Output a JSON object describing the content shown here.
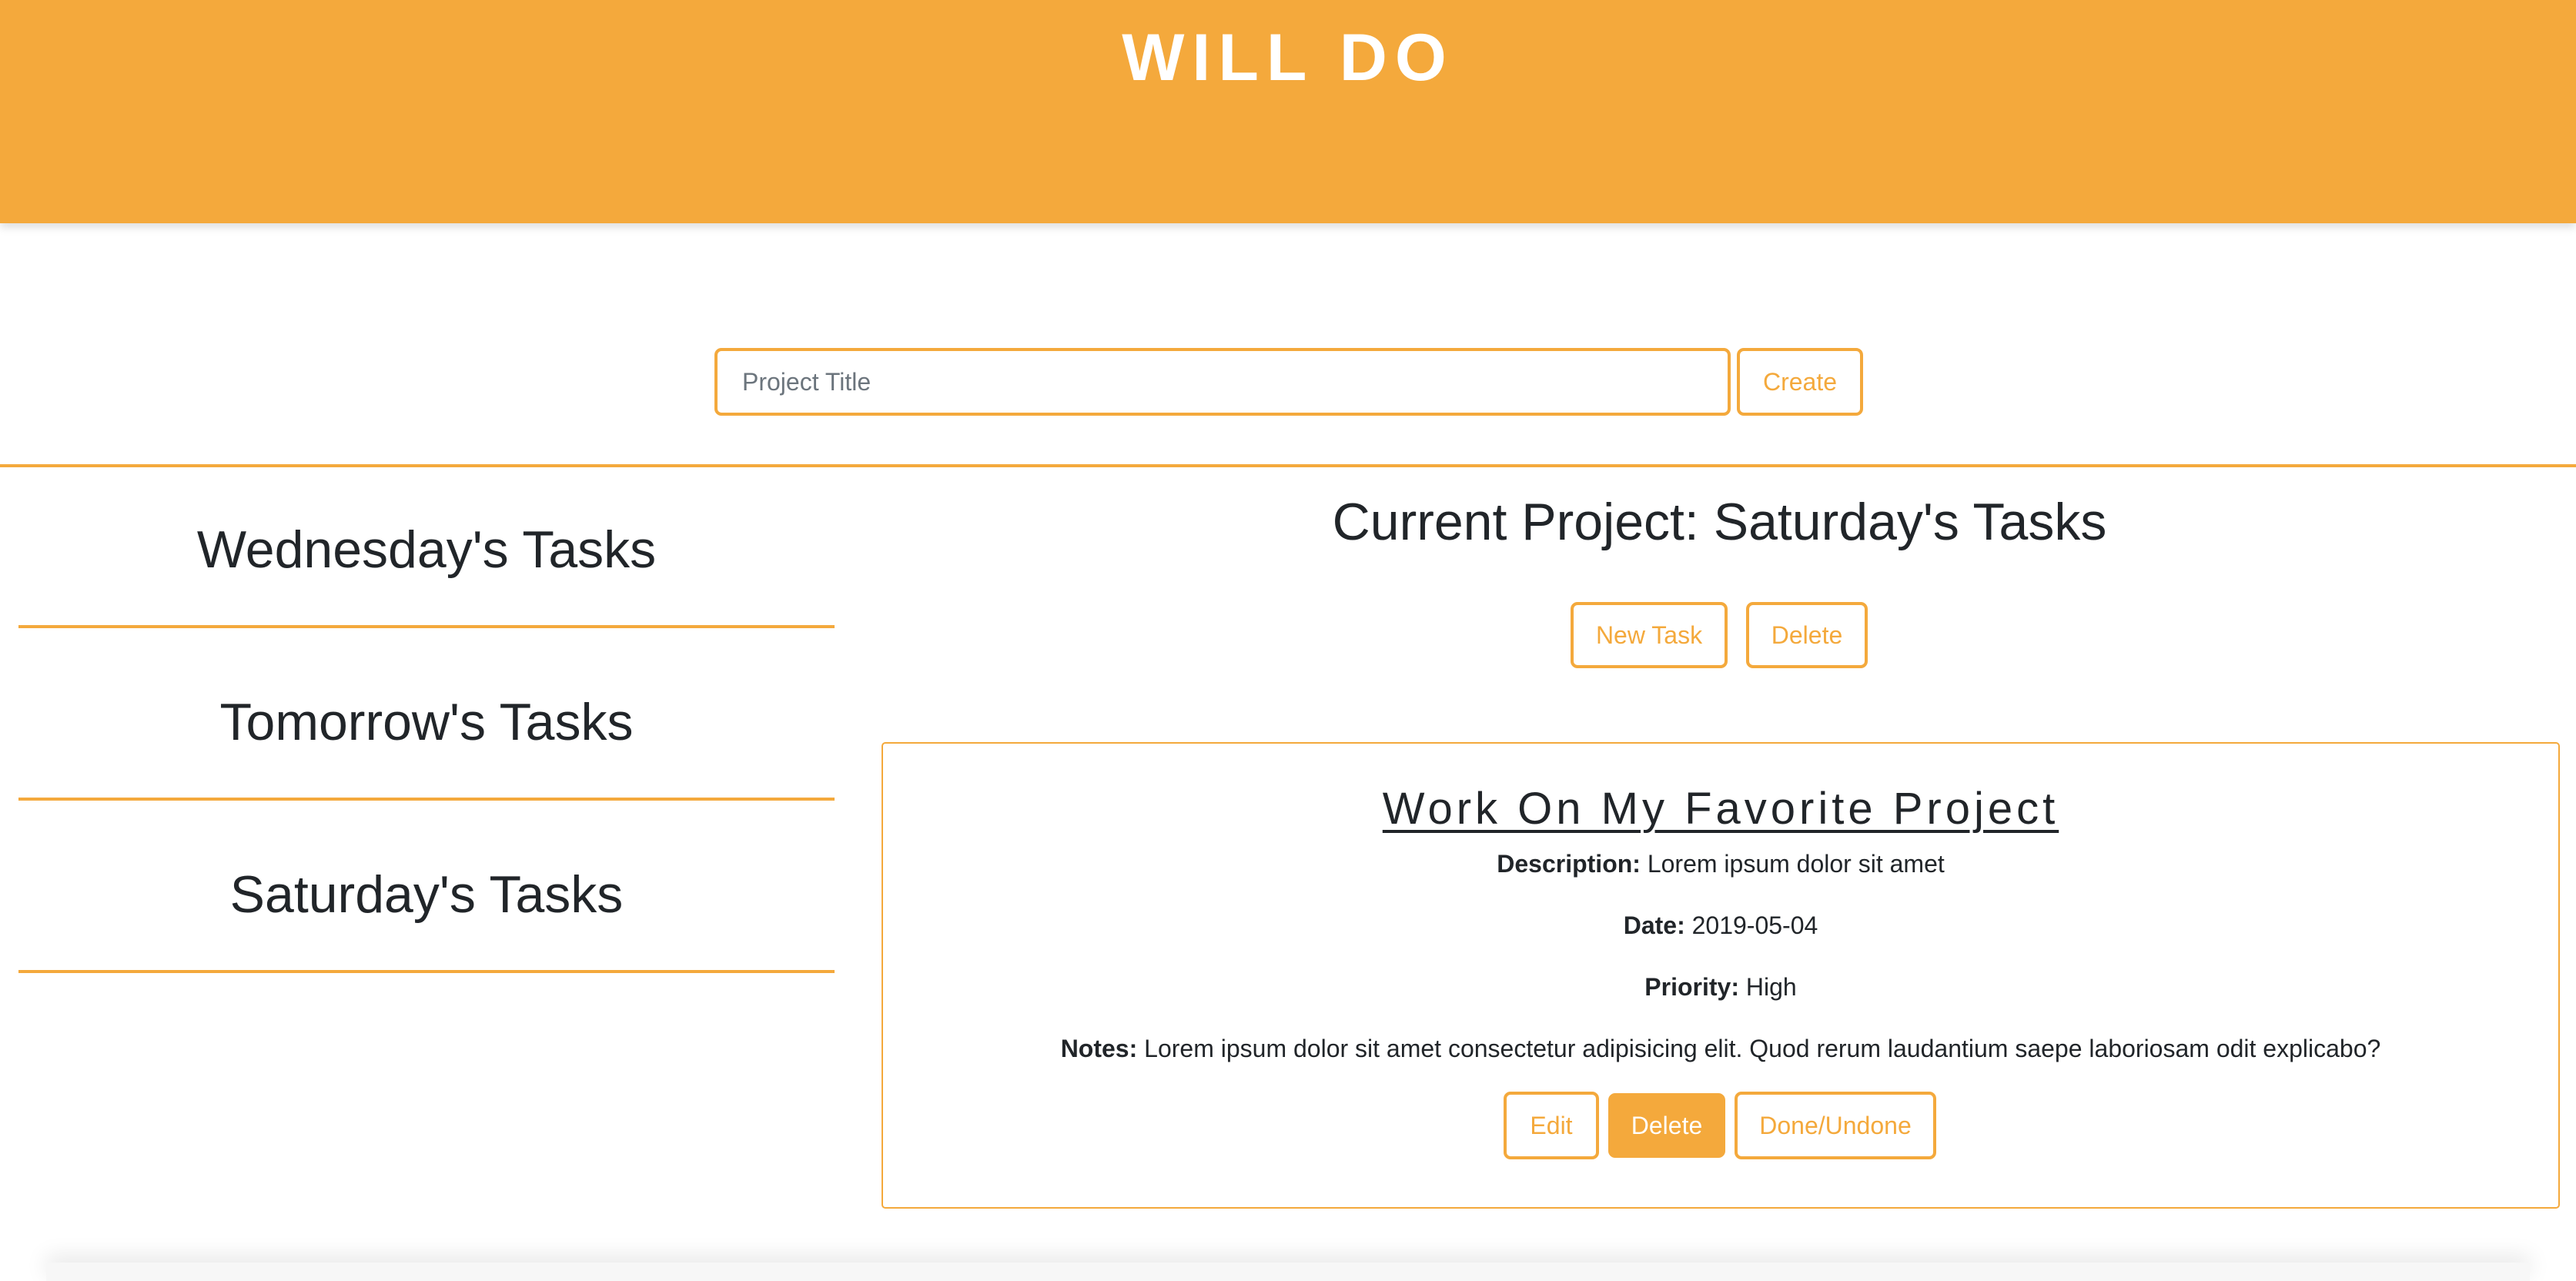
{
  "app": {
    "title": "WILL DO"
  },
  "create_project": {
    "placeholder": "Project Title",
    "value": "",
    "create_label": "Create"
  },
  "projects": [
    {
      "label": "Wednesday's Tasks"
    },
    {
      "label": "Tomorrow's Tasks"
    },
    {
      "label": "Saturday's Tasks"
    }
  ],
  "current_project": {
    "prefix": "Current Project:",
    "name": "Saturday's Tasks",
    "new_task_label": "New Task",
    "delete_label": "Delete"
  },
  "task": {
    "title": "Work On My Favorite Project",
    "description_label": "Description:",
    "description": "Lorem ipsum dolor sit amet",
    "date_label": "Date:",
    "date": "2019-05-04",
    "priority_label": "Priority:",
    "priority": "High",
    "notes_label": "Notes:",
    "notes": "Lorem ipsum dolor sit amet consectetur adipisicing elit. Quod rerum laudantium saepe laboriosam odit explicabo?",
    "edit_label": "Edit",
    "delete_label": "Delete",
    "toggle_label": "Done/Undone"
  },
  "colors": {
    "accent": "#f4a93c",
    "text": "#212529",
    "background": "#ffffff"
  }
}
